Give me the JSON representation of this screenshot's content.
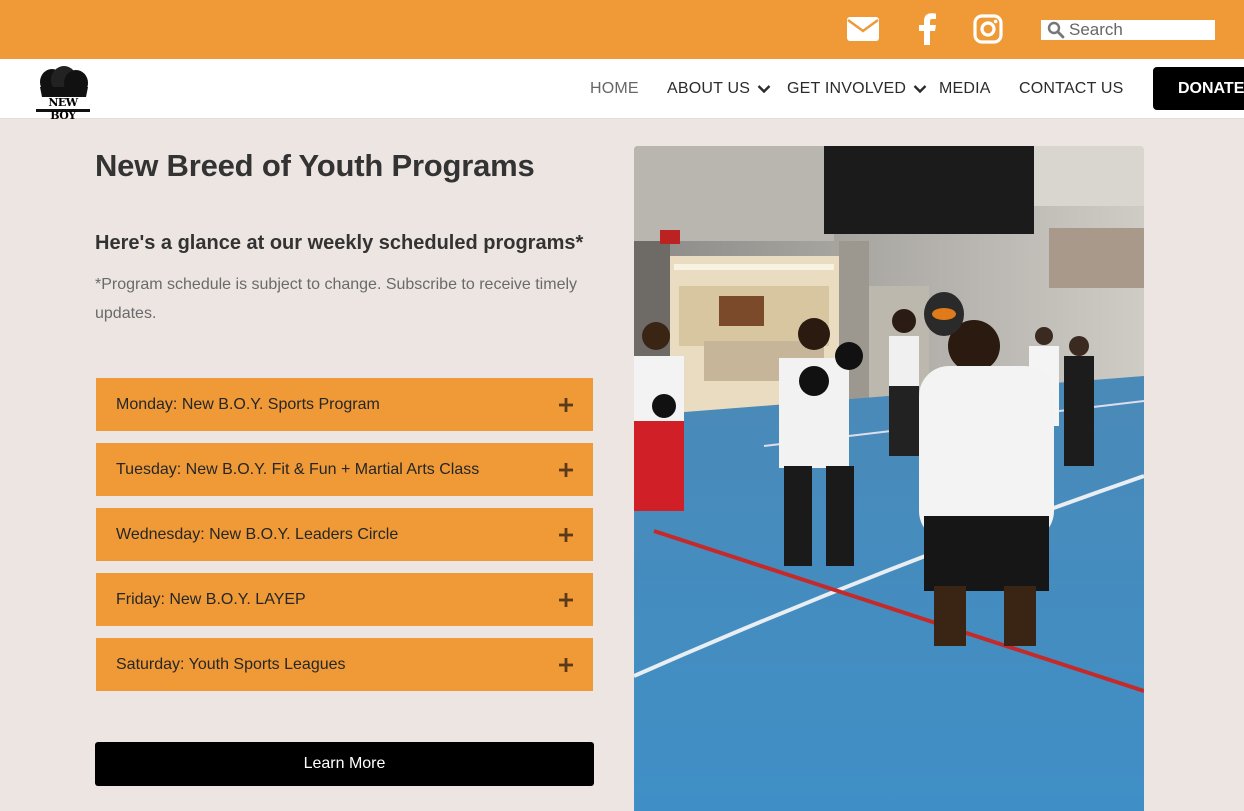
{
  "topbar": {
    "icons": [
      "email-icon",
      "facebook-icon",
      "instagram-icon"
    ],
    "search_placeholder": "Search"
  },
  "nav": {
    "logo_text": "NEW BOY",
    "home": "HOME",
    "about": "ABOUT US",
    "involved": "GET INVOLVED",
    "media": "MEDIA",
    "contact": "CONTACT US",
    "donate": "DONATE"
  },
  "main": {
    "title": "New Breed of Youth Programs",
    "subheading": "Here's a glance at our weekly scheduled programs*",
    "note": "*Program schedule is subject to change. Subscribe to receive timely updates.",
    "programs": [
      "Monday: New B.O.Y. Sports Program",
      "Tuesday: New B.O.Y. Fit & Fun + Martial Arts Class",
      "Wednesday: New B.O.Y. Leaders Circle",
      "Friday: New B.O.Y. LAYEP",
      "Saturday: Youth Sports Leagues"
    ],
    "learn_more": "Learn More"
  },
  "colors": {
    "accent": "#ef9a37",
    "background": "#ede5e1",
    "dark": "#000000"
  }
}
